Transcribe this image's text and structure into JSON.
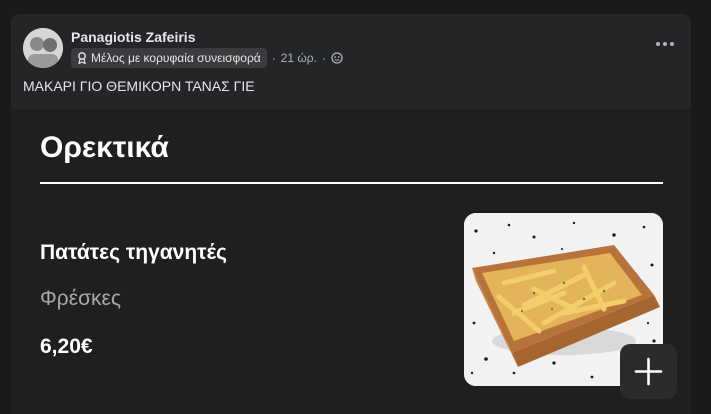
{
  "post": {
    "author": "Panagiotis Zafeiris",
    "badge_label": "Μέλος με κορυφαία συνεισφορά",
    "separator": "·",
    "time": "21 ώρ.",
    "text": "ΜΑΚΑΡΙ ΓΙΟ ΘΕΜΙΚΟΡΝ ΤΑΝΑΣ ΓΙΕ",
    "icons": [
      "avatar",
      "badge-icon",
      "globe-icon",
      "more-options-icon"
    ]
  },
  "menu": {
    "section_title": "Ορεκτικά",
    "item": {
      "name": "Πατάτες τηγανητές",
      "description": "Φρέσκες",
      "price": "6,20€",
      "image": "fries-in-wooden-basket",
      "add_icon": "plus-icon"
    }
  },
  "colors": {
    "page_bg": "#18191a",
    "post_bg": "#242526",
    "menu_bg": "#1f1f1f",
    "primary_text": "#e4e6eb",
    "secondary_text": "#b0b3b8"
  }
}
